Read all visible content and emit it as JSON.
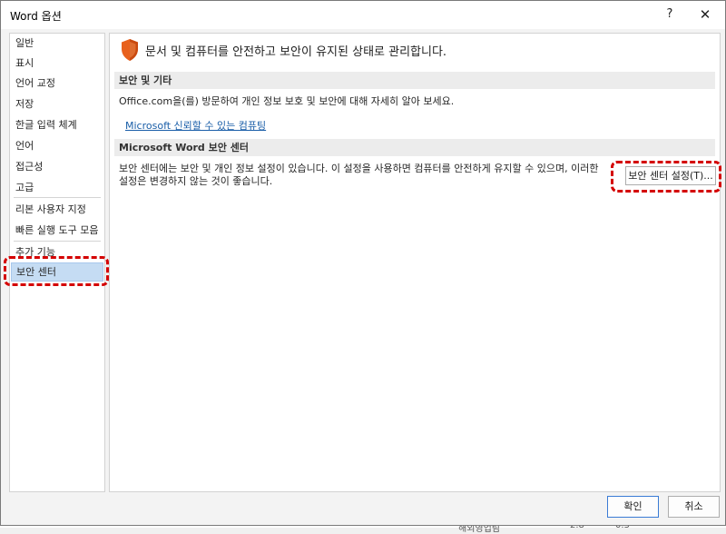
{
  "window": {
    "title": "Word 옵션",
    "help_label": "?",
    "close_label": "✕"
  },
  "nav": {
    "items": [
      {
        "label": "일반"
      },
      {
        "label": "표시"
      },
      {
        "label": "언어 교정"
      },
      {
        "label": "저장"
      },
      {
        "label": "한글 입력 체계"
      },
      {
        "label": "언어"
      },
      {
        "label": "접근성"
      },
      {
        "label": "고급"
      },
      {
        "label": "리본 사용자 지정"
      },
      {
        "label": "빠른 실행 도구 모음"
      },
      {
        "label": "추가 기능"
      },
      {
        "label": "보안 센터",
        "selected": true
      }
    ]
  },
  "main": {
    "header": "문서 및 컴퓨터를 안전하고 보안이 유지된 상태로 관리합니다.",
    "header_icon": "shield-icon",
    "section1": {
      "title": "보안 및 기타",
      "text": "Office.com을(를) 방문하여 개인 정보 보호 및 보안에 대해 자세히 알아 보세요.",
      "link": "Microsoft 신뢰할 수 있는 컴퓨팅"
    },
    "section2": {
      "title": "Microsoft Word 보안 센터",
      "line1": "보안 센터에는 보안 및 개인 정보 설정이 있습니다. 이 설정을 사용하면 컴퓨터를 안전하게 유지할 수 있으며, 이러한",
      "line2": "설정은 변경하지 않는 것이 좋습니다.",
      "button": "보안 센터 설정(T)..."
    }
  },
  "footer": {
    "ok": "확인",
    "cancel": "취소"
  },
  "background": {
    "peek_text": "해외영업팀",
    "peek_num1": "2.8",
    "peek_num2": "0.3"
  },
  "colors": {
    "highlight": "#d40000",
    "selected_nav": "#c5dcf3",
    "link": "#1a5ea8",
    "shield": "#e8601c"
  }
}
